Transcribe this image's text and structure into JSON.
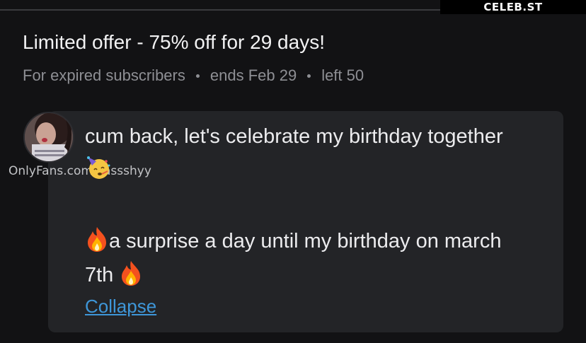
{
  "watermark": {
    "site": "CELEB.ST"
  },
  "offer": {
    "title": "Limited offer - 75% off for 29 days!",
    "audience": "For expired subscribers",
    "ends": "ends Feb 29",
    "left": "left 50"
  },
  "creator": {
    "watermark_text": "OnlyFans.com/cassshyy"
  },
  "message": {
    "line1": "cum back, let's celebrate my birthday together",
    "line2_emoji": "partying-face-icon",
    "line3_prefix_emoji": "fire-icon",
    "line3": "a surprise a day until my birthday on march",
    "line4": "7th",
    "line4_suffix_emoji": "fire-icon",
    "collapse_label": "Collapse"
  },
  "colors": {
    "background": "#121214",
    "card": "#232427",
    "link": "#3e96d8",
    "muted_text": "#8e8f94"
  }
}
